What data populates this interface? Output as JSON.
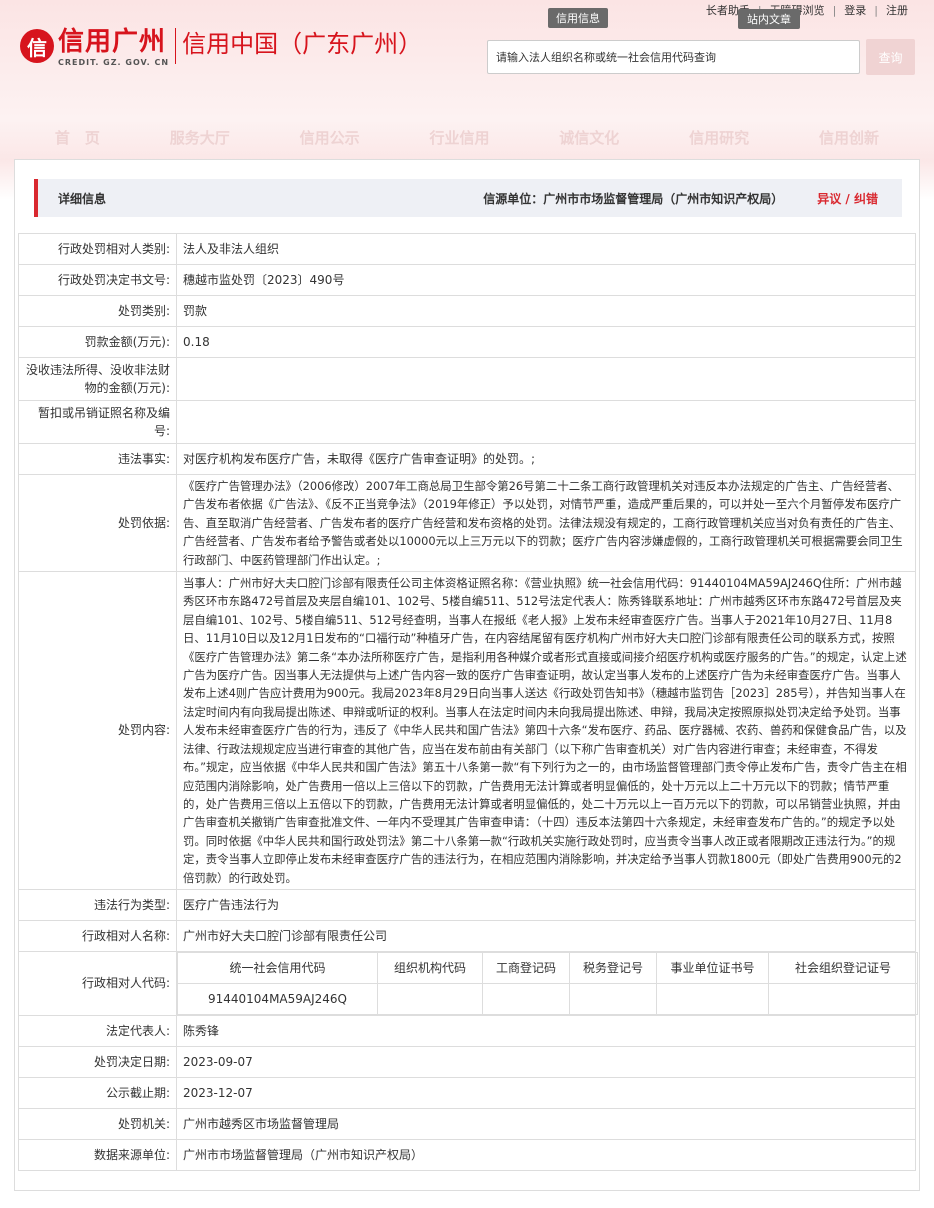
{
  "topbar": {
    "elderly": "长者助手",
    "barrier_free": "无障碍浏览",
    "login": "登录",
    "register": "注册"
  },
  "badges": {
    "info": "信用信息",
    "inner": "站内文章"
  },
  "logo": {
    "mark": "信",
    "cn": "信用广州",
    "en": "CREDIT. GZ. GOV. CN",
    "sub": "信用中国（广东广州）"
  },
  "search": {
    "placeholder": "请输入法人组织名称或统一社会信用代码查询",
    "button": "查询"
  },
  "nav": [
    "首　页",
    "服务大厅",
    "信用公示",
    "行业信用",
    "诚信文化",
    "信用研究",
    "信用创新"
  ],
  "header": {
    "title": "详细信息",
    "source": "信源单位：广州市市场监督管理局（广州市知识产权局）",
    "objection": "异议 / 纠错"
  },
  "rows": {
    "party_type": {
      "label": "行政处罚相对人类别:",
      "value": "法人及非法人组织"
    },
    "doc_no": {
      "label": "行政处罚决定书文号:",
      "value": "穗越市监处罚〔2023〕490号"
    },
    "penalty_type": {
      "label": "处罚类别:",
      "value": "罚款"
    },
    "fine_amount": {
      "label": "罚款金额(万元):",
      "value": "0.18"
    },
    "confiscate": {
      "label": "没收违法所得、没收非法财物的金额(万元):",
      "value": ""
    },
    "license": {
      "label": "暂扣或吊销证照名称及编号:",
      "value": ""
    },
    "facts": {
      "label": "违法事实:",
      "value": "对医疗机构发布医疗广告，未取得《医疗广告审查证明》的处罚。;"
    },
    "basis": {
      "label": "处罚依据:",
      "value": "《医疗广告管理办法》（2006修改）2007年工商总局卫生部令第26号第二十二条工商行政管理机关对违反本办法规定的广告主、广告经营者、广告发布者依据《广告法》、《反不正当竞争法》（2019年修正）予以处罚，对情节严重，造成严重后果的，可以并处一至六个月暂停发布医疗广告、直至取消广告经营者、广告发布者的医疗广告经营和发布资格的处罚。法律法规没有规定的，工商行政管理机关应当对负有责任的广告主、广告经营者、广告发布者给予警告或者处以10000元以上三万元以下的罚款；医疗广告内容涉嫌虚假的，工商行政管理机关可根据需要会同卫生行政部门、中医药管理部门作出认定。;"
    },
    "content": {
      "label": "处罚内容:",
      "value": "当事人：广州市好大夫口腔门诊部有限责任公司主体资格证照名称：《营业执照》统一社会信用代码：91440104MA59AJ246Q住所：广州市越秀区环市东路472号首层及夹层自编101、102号、5楼自编511、512号法定代表人：陈秀锋联系地址：广州市越秀区环市东路472号首层及夹层自编101、102号、5楼自编511、512号经查明，当事人在报纸《老人报》上发布未经审查医疗广告。当事人于2021年10月27日、11月8日、11月10日以及12月1日发布的“口福行动”种植牙广告，在内容结尾留有医疗机构广州市好大夫口腔门诊部有限责任公司的联系方式，按照《医疗广告管理办法》第二条“本办法所称医疗广告，是指利用各种媒介或者形式直接或间接介绍医疗机构或医疗服务的广告。”的规定，认定上述广告为医疗广告。因当事人无法提供与上述广告内容一致的医疗广告审查证明，故认定当事人发布的上述医疗广告为未经审查医疗广告。当事人发布上述4则广告应计费用为900元。我局2023年8月29日向当事人送达《行政处罚告知书》（穗越市监罚告［2023］285号），并告知当事人在法定时间内有向我局提出陈述、申辩或听证的权利。当事人在法定时间内未向我局提出陈述、申辩，我局决定按照原拟处罚决定给予处罚。当事人发布未经审查医疗广告的行为，违反了《中华人民共和国广告法》第四十六条“发布医疗、药品、医疗器械、农药、兽药和保健食品广告，以及法律、行政法规规定应当进行审查的其他广告，应当在发布前由有关部门（以下称广告审查机关）对广告内容进行审查；未经审查，不得发布。”规定，应当依据《中华人民共和国广告法》第五十八条第一款“有下列行为之一的，由市场监督管理部门责令停止发布广告，责令广告主在相应范围内消除影响，处广告费用一倍以上三倍以下的罚款，广告费用无法计算或者明显偏低的，处十万元以上二十万元以下的罚款；情节严重的，处广告费用三倍以上五倍以下的罚款，广告费用无法计算或者明显偏低的，处二十万元以上一百万元以下的罚款，可以吊销营业执照，并由广告审查机关撤销广告审查批准文件、一年内不受理其广告审查申请：（十四）违反本法第四十六条规定，未经审查发布广告的。”的规定予以处罚。同时依据《中华人民共和国行政处罚法》第二十八条第一款“行政机关实施行政处罚时，应当责令当事人改正或者限期改正违法行为。”的规定，责令当事人立即停止发布未经审查医疗广告的违法行为，在相应范围内消除影响，并决定给予当事人罚款1800元（即处广告费用900元的2倍罚款）的行政处罚。"
    },
    "violation_type": {
      "label": "违法行为类型:",
      "value": "医疗广告违法行为"
    },
    "party_name": {
      "label": "行政相对人名称:",
      "value": "广州市好大夫口腔门诊部有限责任公司"
    },
    "party_code": {
      "label": "行政相对人代码:",
      "headers": [
        "统一社会信用代码",
        "组织机构代码",
        "工商登记码",
        "税务登记号",
        "事业单位证书号",
        "社会组织登记证号"
      ],
      "values": [
        "91440104MA59AJ246Q",
        "",
        "",
        "",
        "",
        ""
      ]
    },
    "legal_rep": {
      "label": "法定代表人:",
      "value": "陈秀锋"
    },
    "decision_date": {
      "label": "处罚决定日期:",
      "value": "2023-09-07"
    },
    "publish_end": {
      "label": "公示截止期:",
      "value": "2023-12-07"
    },
    "authority": {
      "label": "处罚机关:",
      "value": "广州市越秀区市场监督管理局"
    },
    "data_source": {
      "label": "数据来源单位:",
      "value": "广州市市场监督管理局（广州市知识产权局）"
    }
  }
}
